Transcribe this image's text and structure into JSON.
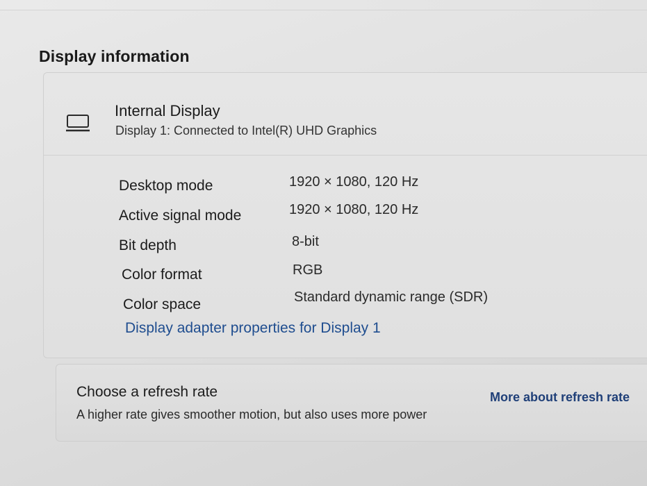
{
  "section": {
    "heading": "Display information"
  },
  "display": {
    "icon": "laptop-icon",
    "name": "Internal Display",
    "connection": "Display 1: Connected to Intel(R) UHD Graphics"
  },
  "properties": [
    {
      "label": "Desktop mode",
      "value": "1920 × 1080, 120 Hz"
    },
    {
      "label": "Active signal mode",
      "value": "1920 × 1080, 120 Hz"
    },
    {
      "label": "Bit depth",
      "value": "8-bit"
    },
    {
      "label": "Color format",
      "value": "RGB"
    },
    {
      "label": "Color space",
      "value": "Standard dynamic range (SDR)"
    }
  ],
  "adapter_link": "Display adapter properties for Display 1",
  "refresh": {
    "title": "Choose a refresh rate",
    "description": "A higher rate gives smoother motion, but also uses more power",
    "link": "More about refresh rate"
  },
  "colors": {
    "link": "#1f4d8f",
    "background": "#e1e1e1"
  }
}
